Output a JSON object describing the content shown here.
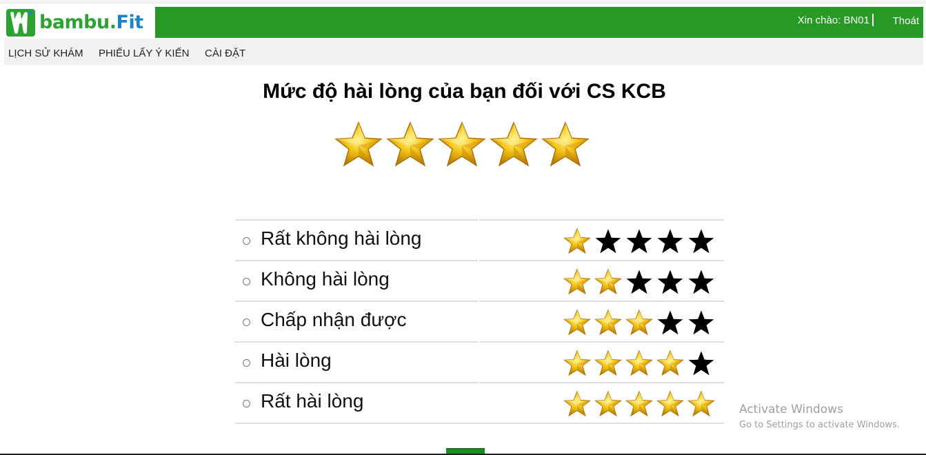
{
  "brand": {
    "name_part1": "bambu.",
    "name_part2": "Fit",
    "color_green": "#279a26",
    "color_blue": "#1b84c4"
  },
  "header": {
    "greeting": "Xin chào: BN01",
    "logout": "Thoát"
  },
  "nav": {
    "items": [
      "LỊCH SỬ KHÁM",
      "PHIẾU LẤY Ý KIẾN",
      "CÀI ĐẶT"
    ]
  },
  "survey": {
    "title": "Mức độ hài lòng của bạn đối với CS KCB",
    "current_rating": 5,
    "max_rating": 5,
    "options": [
      {
        "label": "Rất không hài lòng",
        "stars": 1,
        "selected": false
      },
      {
        "label": "Không hài lòng",
        "stars": 2,
        "selected": false
      },
      {
        "label": "Chấp nhận được",
        "stars": 3,
        "selected": false
      },
      {
        "label": "Hài lòng",
        "stars": 4,
        "selected": false
      },
      {
        "label": "Rất hài lòng",
        "stars": 5,
        "selected": false
      }
    ]
  },
  "watermark": {
    "line1": "Activate Windows",
    "line2": "Go to Settings to activate Windows."
  },
  "icons": {
    "star_filled": "gold-star-icon",
    "star_empty": "black-star-icon",
    "logo": "bambu-logo-icon"
  }
}
